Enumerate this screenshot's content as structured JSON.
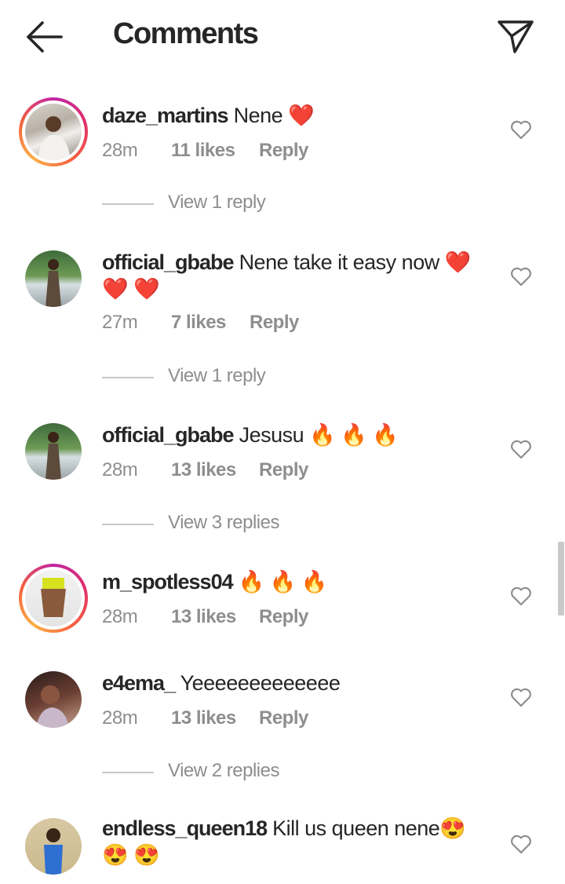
{
  "header": {
    "title": "Comments",
    "back_icon": "arrow-left-icon",
    "send_icon": "paper-plane-icon"
  },
  "comments": [
    {
      "username": "daze_martins",
      "text": "Nene ❤️",
      "time": "28m",
      "likes": "11 likes",
      "reply": "Reply",
      "view_replies": "View 1 reply",
      "story_ring": true
    },
    {
      "username": "official_gbabe",
      "text": "Nene take it easy now ❤️❤️ ❤️",
      "time": "27m",
      "likes": "7 likes",
      "reply": "Reply",
      "view_replies": "View 1 reply",
      "story_ring": false
    },
    {
      "username": "official_gbabe",
      "text": "Jesusu 🔥 🔥 🔥",
      "time": "28m",
      "likes": "13 likes",
      "reply": "Reply",
      "view_replies": "View 3 replies",
      "story_ring": false
    },
    {
      "username": "m_spotless04",
      "text": "🔥 🔥 🔥",
      "time": "28m",
      "likes": "13 likes",
      "reply": "Reply",
      "view_replies": "",
      "story_ring": true
    },
    {
      "username": "e4ema_",
      "text": "Yeeeeeeeeeeeee",
      "time": "28m",
      "likes": "13 likes",
      "reply": "Reply",
      "view_replies": "View 2 replies",
      "story_ring": false
    },
    {
      "username": "endless_queen18",
      "text": "Kill us queen nene😍😍 😍",
      "time": "",
      "likes": "",
      "reply": "",
      "view_replies": "",
      "story_ring": false
    }
  ],
  "colors": {
    "text": "#262626",
    "secondary": "#8e8e8e",
    "heart": "#e0245e",
    "fire": "#f57c00"
  },
  "icons": {
    "like": "heart-outline-icon"
  }
}
